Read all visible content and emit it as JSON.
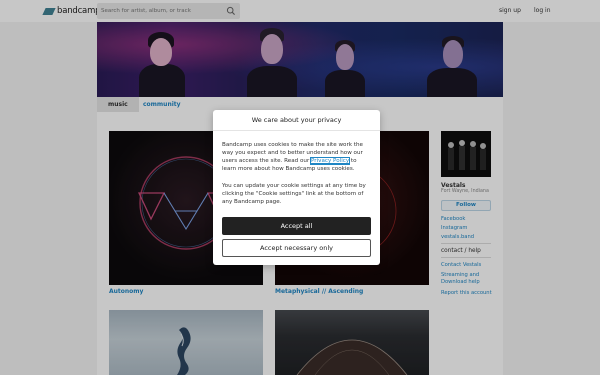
{
  "header": {
    "brand": "bandcamp",
    "search_placeholder": "Search for artist, album, or track",
    "signup": "sign up",
    "login": "log in"
  },
  "tabs": [
    {
      "label": "music",
      "active": true
    },
    {
      "label": "community",
      "active": false
    }
  ],
  "albums": [
    {
      "title": "Autonomy"
    },
    {
      "title": "Metaphysical // Ascending"
    },
    {
      "title": ""
    },
    {
      "title": ""
    }
  ],
  "sidebar": {
    "band_name": "Vestals",
    "location": "Fort Wayne, Indiana",
    "follow_label": "Follow",
    "links": [
      "Facebook",
      "Instagram",
      "vestals.band"
    ],
    "contact_heading": "contact / help",
    "contact_links": [
      "Contact Vestals",
      "Streaming and",
      "Download help",
      "Report this account"
    ]
  },
  "cookie_modal": {
    "title": "We care about your privacy",
    "p1_before": "Bandcamp uses cookies to make the site work the way you expect and to better understand how our users access the site. Read our ",
    "p1_link": "Privacy Policy",
    "p1_after": " to learn more about how Bandcamp uses cookies.",
    "p2": "You can update your cookie settings at any time by clicking the \"Cookie settings\" link at the bottom of any Bandcamp page.",
    "accept_all": "Accept all",
    "accept_necessary": "Accept necessary only"
  },
  "colors": {
    "link": "#1f86c4",
    "brand": "#408294",
    "dark_button": "#222222"
  }
}
